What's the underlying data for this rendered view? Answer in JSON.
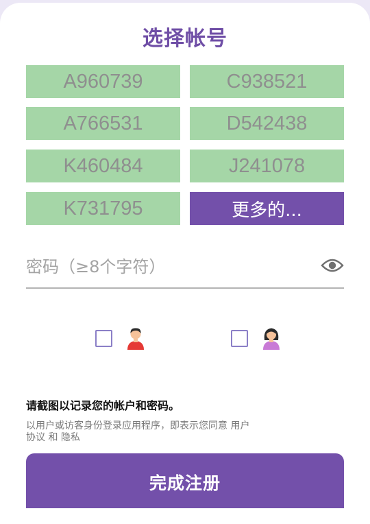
{
  "header": {
    "title": "选择帐号"
  },
  "accounts": [
    "A960739",
    "C938521",
    "A766531",
    "D542438",
    "K460484",
    "J241078",
    "K731795"
  ],
  "more_label": "更多的...",
  "password": {
    "placeholder": "密码（≥8个字符）",
    "value": "",
    "icon": "eye-icon"
  },
  "gender": {
    "male_icon": "male-avatar-icon",
    "female_icon": "female-avatar-icon"
  },
  "notice": "请截图以记录您的帐户和密码。",
  "terms": {
    "prefix": "以用户或访客身份登录应用程序，即表示您同意",
    "user_agreement": "用户协议",
    "and": "和",
    "privacy": "隐私"
  },
  "submit_label": "完成注册",
  "colors": {
    "accent": "#7350aa",
    "account_bg": "#a5d6a7",
    "account_text": "#8f8f8f"
  }
}
